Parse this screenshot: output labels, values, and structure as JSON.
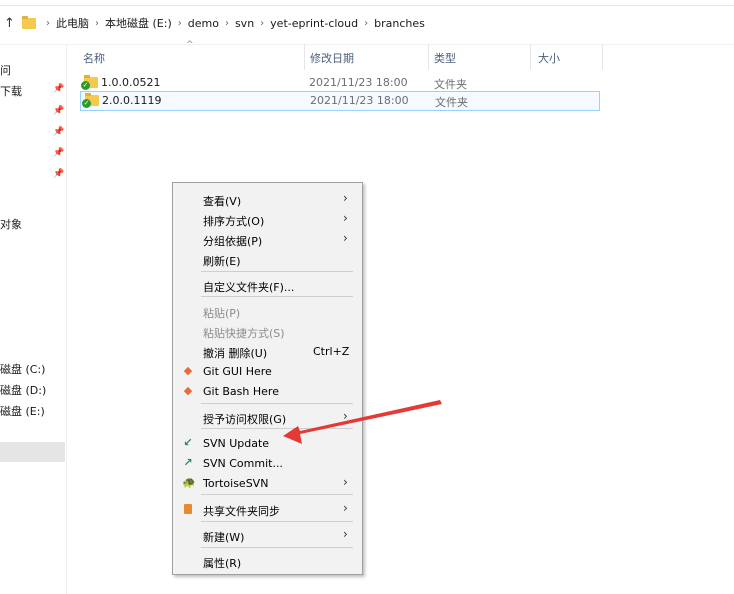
{
  "breadcrumb": {
    "items": [
      "此电脑",
      "本地磁盘 (E:)",
      "demo",
      "svn",
      "yet-eprint-cloud",
      "branches"
    ]
  },
  "nav": {
    "items": [
      {
        "label": "问"
      },
      {
        "label": "下载"
      },
      {
        "label": "对象"
      },
      {
        "label": "磁盘 (C:)"
      },
      {
        "label": "磁盘 (D:)"
      },
      {
        "label": "磁盘 (E:)"
      }
    ]
  },
  "columns": {
    "name": "名称",
    "date": "修改日期",
    "type": "类型",
    "size": "大小"
  },
  "files": [
    {
      "name": "1.0.0.0521",
      "date": "2021/11/23 18:00",
      "type": "文件夹"
    },
    {
      "name": "2.0.0.1119",
      "date": "2021/11/23 18:00",
      "type": "文件夹"
    }
  ],
  "context_menu": {
    "items": [
      {
        "label": "查看(V)"
      },
      {
        "label": "排序方式(O)"
      },
      {
        "label": "分组依据(P)"
      },
      {
        "label": "刷新(E)"
      },
      {
        "label": "自定义文件夹(F)..."
      },
      {
        "label": "粘贴(P)"
      },
      {
        "label": "粘贴快捷方式(S)"
      },
      {
        "label": "撤消 删除(U)",
        "shortcut": "Ctrl+Z"
      },
      {
        "label": "Git GUI Here"
      },
      {
        "label": "Git Bash Here"
      },
      {
        "label": "授予访问权限(G)"
      },
      {
        "label": "SVN Update"
      },
      {
        "label": "SVN Commit..."
      },
      {
        "label": "TortoiseSVN"
      },
      {
        "label": "共享文件夹同步"
      },
      {
        "label": "新建(W)"
      },
      {
        "label": "属性(R)"
      }
    ]
  },
  "colors": {
    "annotation_arrow": "#e53935",
    "selection_border": "#99d1ff"
  }
}
